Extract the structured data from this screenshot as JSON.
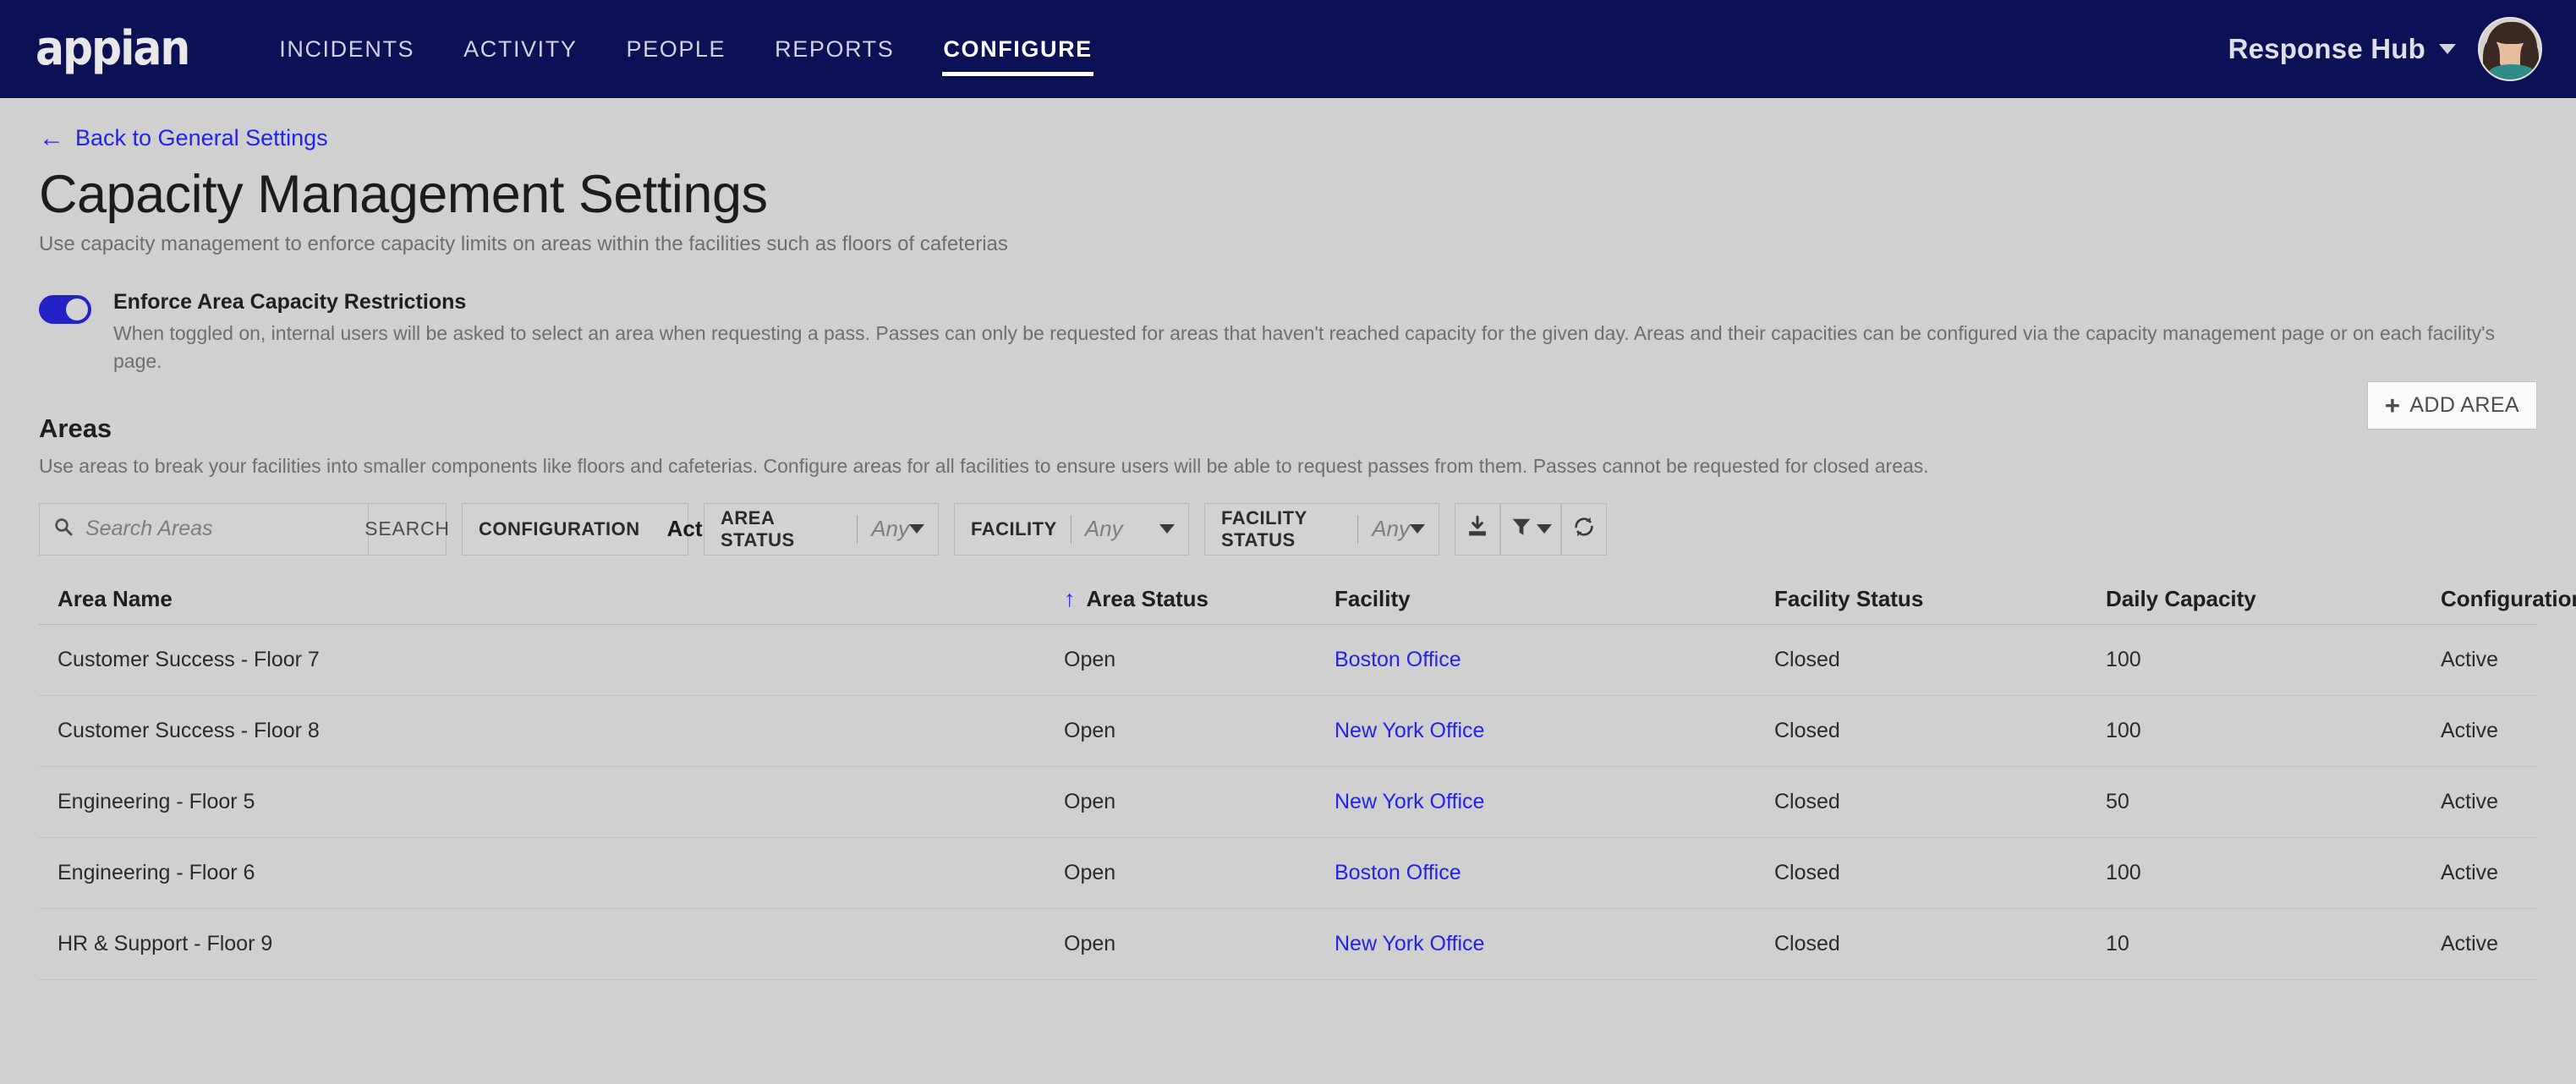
{
  "nav": {
    "logo_text": "appian",
    "items": [
      {
        "label": "INCIDENTS",
        "active": false
      },
      {
        "label": "ACTIVITY",
        "active": false
      },
      {
        "label": "PEOPLE",
        "active": false
      },
      {
        "label": "REPORTS",
        "active": false
      },
      {
        "label": "CONFIGURE",
        "active": true
      }
    ],
    "site_name": "Response Hub",
    "site_caret_icon": "chevron-down-icon",
    "avatar_icon": "user-avatar",
    "bar_color": "#0c1054"
  },
  "back_link": {
    "label": "Back to General Settings",
    "icon": "arrow-left-icon",
    "color": "#2323ee"
  },
  "header": {
    "title": "Capacity Management Settings",
    "subtitle": "Use capacity management to enforce capacity limits on areas within the facilities such as floors of cafeterias"
  },
  "enforce_toggle": {
    "state": "on",
    "title": "Enforce Area Capacity Restrictions",
    "description": "When toggled on, internal users will be asked to select an area when requesting a pass. Passes can only be requested for areas that haven't reached capacity for the given day. Areas and their capacities can be configured via the capacity management page or on each facility's page.",
    "accent_color": "#2222c7"
  },
  "areas": {
    "title": "Areas",
    "description": "Use areas to break your facilities into smaller components like floors and cafeterias. Configure areas for all facilities to ensure users will be able to request passes from them. Passes cannot be requested for closed areas.",
    "add_button": {
      "label": "ADD AREA",
      "icon": "plus-icon"
    }
  },
  "filters": {
    "search": {
      "value": "",
      "placeholder": "Search Areas",
      "icon": "search-icon"
    },
    "search_button": "SEARCH",
    "configuration": {
      "label": "CONFIGURATION",
      "value": "Active",
      "clear_icon": "clear-circle-icon",
      "caret_icon": "caret-down-icon"
    },
    "area_status": {
      "label": "AREA STATUS",
      "value": "Any",
      "caret_icon": "caret-down-icon"
    },
    "facility": {
      "label": "FACILITY",
      "value": "Any",
      "caret_icon": "caret-down-icon"
    },
    "facility_status": {
      "label": "FACILITY STATUS",
      "value": "Any",
      "caret_icon": "caret-down-icon"
    },
    "export_icon": "download-icon",
    "filter_icon": "funnel-icon",
    "refresh_icon": "refresh-icon"
  },
  "table": {
    "columns": [
      {
        "key": "area_name",
        "label": "Area Name",
        "sort": "asc",
        "sort_icon": "sort-arrow-up-icon"
      },
      {
        "key": "area_status",
        "label": "Area Status"
      },
      {
        "key": "facility",
        "label": "Facility"
      },
      {
        "key": "facility_status",
        "label": "Facility Status"
      },
      {
        "key": "daily_capacity",
        "label": "Daily Capacity"
      },
      {
        "key": "configuration",
        "label": "Configuration"
      }
    ],
    "rows": [
      {
        "area_name": "Customer Success - Floor 7",
        "area_status": "Open",
        "facility": "Boston Office",
        "facility_status": "Closed",
        "daily_capacity": "100",
        "configuration": "Active"
      },
      {
        "area_name": "Customer Success - Floor 8",
        "area_status": "Open",
        "facility": "New York Office",
        "facility_status": "Closed",
        "daily_capacity": "100",
        "configuration": "Active"
      },
      {
        "area_name": "Engineering - Floor 5",
        "area_status": "Open",
        "facility": "New York Office",
        "facility_status": "Closed",
        "daily_capacity": "50",
        "configuration": "Active"
      },
      {
        "area_name": "Engineering - Floor 6",
        "area_status": "Open",
        "facility": "Boston Office",
        "facility_status": "Closed",
        "daily_capacity": "100",
        "configuration": "Active"
      },
      {
        "area_name": "HR & Support - Floor 9",
        "area_status": "Open",
        "facility": "New York Office",
        "facility_status": "Closed",
        "daily_capacity": "10",
        "configuration": "Active"
      }
    ],
    "row_menu_icon": "kebab-menu-icon"
  }
}
